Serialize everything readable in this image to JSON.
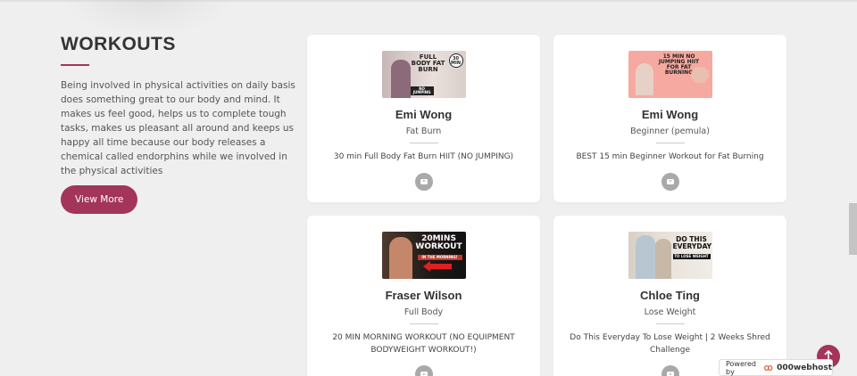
{
  "section": {
    "title": "WORKOUTS",
    "description": "Being involved in physical activities on daily basis does something great to our body and mind. It makes us feel good, helps us to complete tough tasks, makes us pleasant all around and keeps us happy all time because our body releases a chemical called endorphins while we involved in the physical activities",
    "view_more_label": "View More"
  },
  "cards": [
    {
      "trainer": "Emi Wong",
      "category": "Fat Burn",
      "video_title": "30 min Full Body Fat Burn HIIT (NO JUMPING)",
      "thumb_text": "FULL BODY FAT BURN",
      "thumb_badge": "30 MIN",
      "thumb_tag": "NO JUMPING",
      "icon": "youtube-icon"
    },
    {
      "trainer": "Emi Wong",
      "category": "Beginner (pemula)",
      "video_title": "BEST 15 min Beginner Workout for Fat Burning",
      "thumb_text": "15 MIN NO JUMPING HIIT FOR FAT BURNING",
      "icon": "youtube-icon"
    },
    {
      "trainer": "Fraser Wilson",
      "category": "Full Body",
      "video_title": "20 MIN MORNING WORKOUT (NO EQUIPMENT BODYWEIGHT WORKOUT!)",
      "thumb_text": "20MINS WORKOUT",
      "thumb_tag": "IN THE MORNING!",
      "icon": "youtube-icon"
    },
    {
      "trainer": "Chloe Ting",
      "category": "Lose Weight",
      "video_title": "Do This Everyday To Lose Weight | 2 Weeks Shred Challenge",
      "thumb_text": "DO THIS EVERYDAY",
      "thumb_tag": "TO LOSE WEIGHT",
      "icon": "youtube-icon"
    }
  ],
  "footer": {
    "powered_by": "Powered by",
    "host": "000webhost"
  },
  "colors": {
    "accent": "#a3345a",
    "background": "#efefef",
    "icon_grey": "#a9a9a9"
  }
}
